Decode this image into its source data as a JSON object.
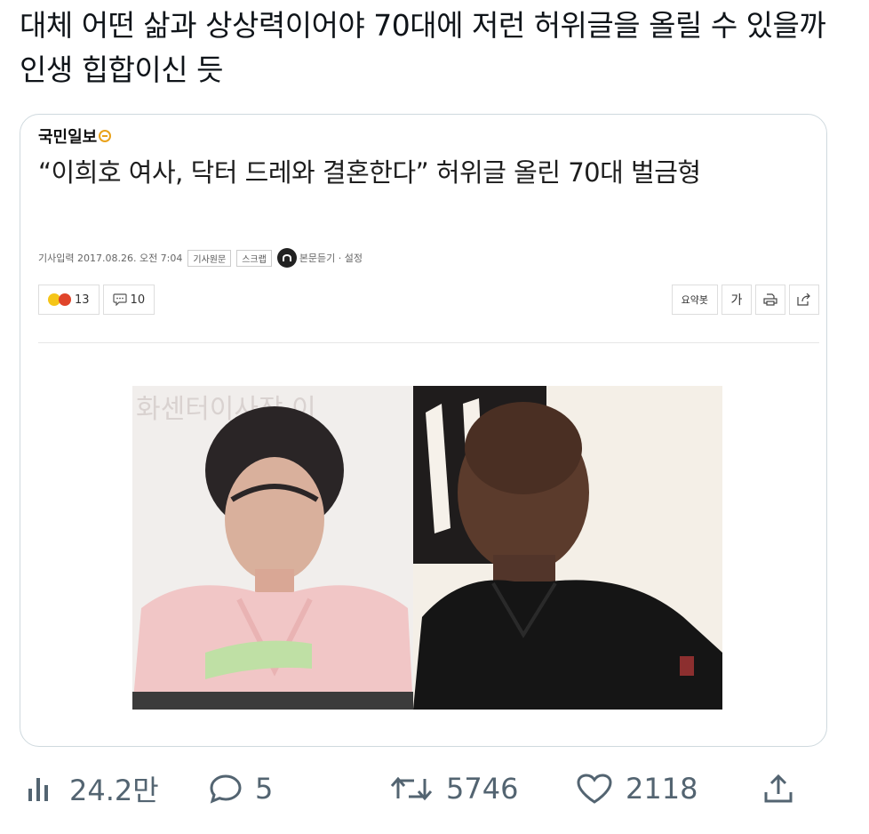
{
  "tweet": {
    "text": "대체 어떤 삶과 상상력이어야 70대에 저런 허위글을 올릴 수 있을까 인생 힙합이신 듯"
  },
  "card": {
    "publisher": "국민일보",
    "headline": "“이희호 여사, 닥터 드레와 결혼한다” 허위글 올린 70대 벌금형",
    "meta": {
      "input_label": "기사입력 2017.08.26. 오전 7:04",
      "original_label": "기사원문",
      "scrap_label": "스크랩",
      "listen_label": "본문듣기 · 설정"
    },
    "reactions": {
      "emoji_count": "13",
      "comment_count": "10"
    },
    "tools": {
      "summary_label": "요약봇",
      "font_label": "가"
    },
    "photo": {
      "left_sign_text": "화센터이사장  이"
    }
  },
  "actions": {
    "views": "24.2만",
    "replies": "5",
    "retweets": "5746",
    "likes": "2118"
  },
  "colors": {
    "icon_gray": "#536471",
    "border": "#cfd9de",
    "text": "#0f1419"
  }
}
